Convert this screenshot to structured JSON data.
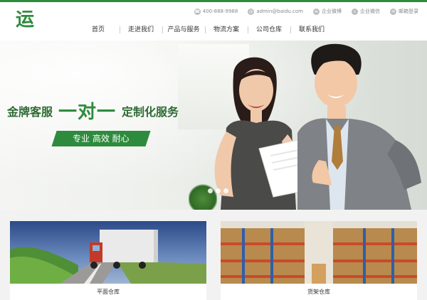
{
  "header": {
    "logo_text": "运",
    "contacts": [
      {
        "icon": "phone-icon",
        "text": "400-888-9988"
      },
      {
        "icon": "email-icon",
        "text": "admin@baidu.com"
      },
      {
        "icon": "weibo-icon",
        "text": "企业微博"
      },
      {
        "icon": "wechat-icon",
        "text": "企业微信"
      },
      {
        "icon": "mail-icon",
        "text": "邮箱登录"
      }
    ],
    "nav": [
      "首页",
      "走进我们",
      "产品与服务",
      "物流方案",
      "公司仓库",
      "联系我们"
    ]
  },
  "banner": {
    "headline_left": "金牌客服",
    "headline_big": "一对一",
    "headline_right": "定制化服务",
    "slogan": "专业 高效 耐心"
  },
  "cards": [
    {
      "label": "平面仓库"
    },
    {
      "label": "货架仓库"
    }
  ],
  "colors": {
    "brand": "#2e8b3d"
  }
}
